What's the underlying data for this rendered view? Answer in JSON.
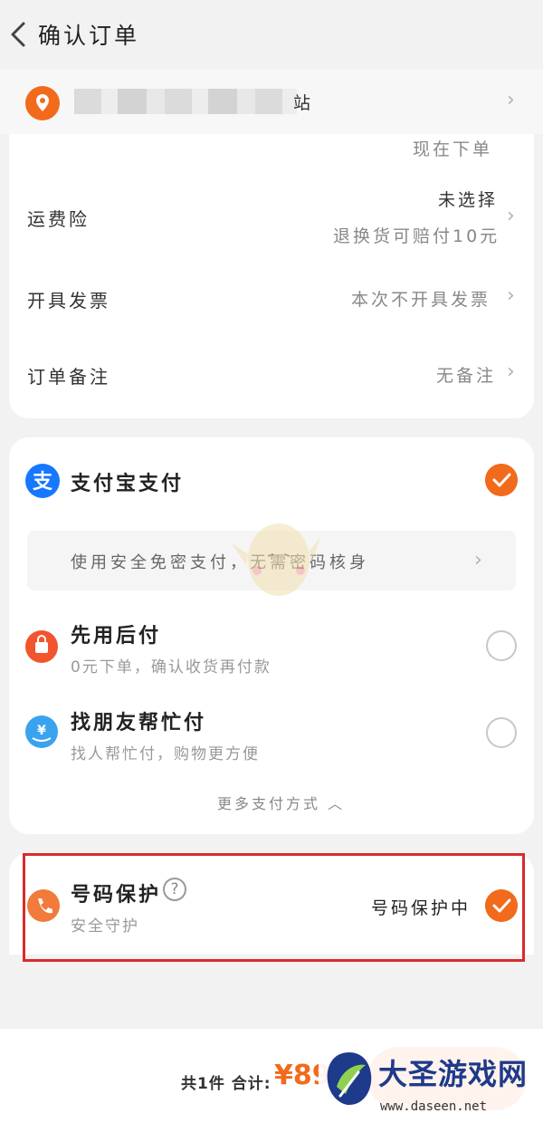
{
  "header": {
    "title": "确认订单"
  },
  "address": {
    "visible_tail": "站"
  },
  "order_info": {
    "order_time_value": "现在下单",
    "shipping_insurance": {
      "label": "运费险",
      "status": "未选择",
      "note": "退换货可赔付10元"
    },
    "invoice": {
      "label": "开具发票",
      "value": "本次不开具发票"
    },
    "remark": {
      "label": "订单备注",
      "value": "无备注"
    }
  },
  "payment": {
    "alipay": {
      "label": "支付宝支付",
      "selected": true
    },
    "secure_banner": "使用安全免密支付，无需密码核身",
    "pay_later": {
      "label": "先用后付",
      "sub": "0元下单，确认收货再付款",
      "selected": false
    },
    "friend_pay": {
      "label": "找朋友帮忙付",
      "sub": "找人帮忙付，购物更方便",
      "selected": false
    },
    "more_methods": "更多支付方式"
  },
  "number_protection": {
    "label": "号码保护",
    "sub": "安全守护",
    "help_glyph": "?",
    "status": "号码保护中",
    "enabled": true
  },
  "footer": {
    "count_label": "共1件",
    "total_label": "合计:",
    "total_price": "¥89"
  },
  "watermark": {
    "name": "大圣游戏网",
    "url": "www.daseen.net"
  },
  "colors": {
    "accent": "#f26a1b",
    "alipay_blue": "#1677ff",
    "highlight_red": "#d92b2b"
  }
}
